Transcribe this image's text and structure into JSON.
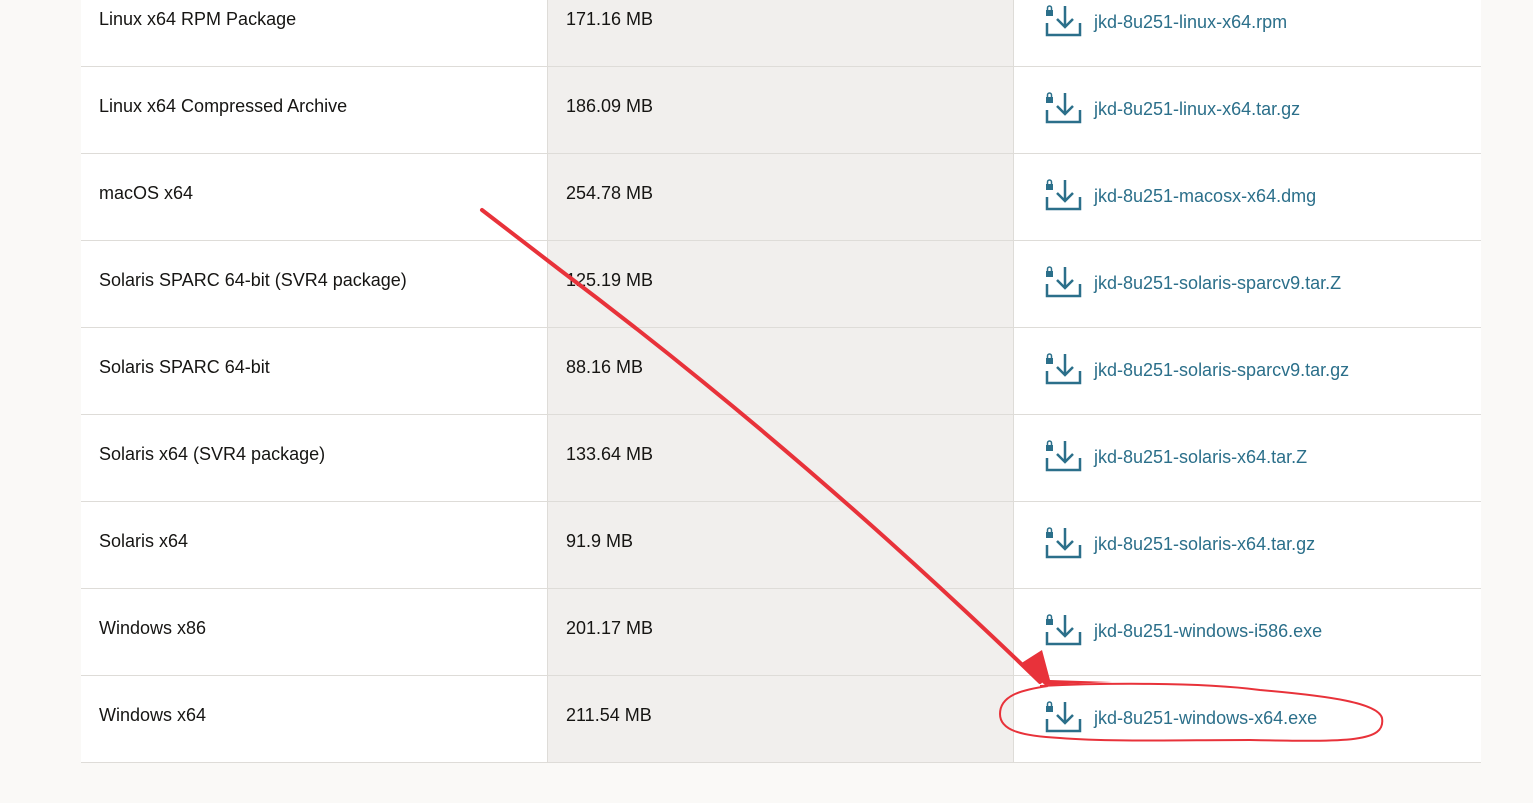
{
  "rows": [
    {
      "product": "Linux x64 RPM Package",
      "size": "171.16 MB",
      "file": "jkd-8u251-linux-x64.rpm"
    },
    {
      "product": "Linux x64 Compressed Archive",
      "size": "186.09 MB",
      "file": "jkd-8u251-linux-x64.tar.gz"
    },
    {
      "product": "macOS x64",
      "size": "254.78 MB",
      "file": "jkd-8u251-macosx-x64.dmg"
    },
    {
      "product": "Solaris SPARC 64-bit (SVR4 package)",
      "size": "125.19 MB",
      "file": "jkd-8u251-solaris-sparcv9.tar.Z"
    },
    {
      "product": "Solaris SPARC 64-bit",
      "size": "88.16 MB",
      "file": "jkd-8u251-solaris-sparcv9.tar.gz"
    },
    {
      "product": "Solaris x64 (SVR4 package)",
      "size": "133.64 MB",
      "file": "jkd-8u251-solaris-x64.tar.Z"
    },
    {
      "product": "Solaris x64",
      "size": "91.9 MB",
      "file": "jkd-8u251-solaris-x64.tar.gz"
    },
    {
      "product": "Windows x86",
      "size": "201.17 MB",
      "file": "jkd-8u251-windows-i586.exe"
    },
    {
      "product": "Windows x64",
      "size": "211.54 MB",
      "file": "jkd-8u251-windows-x64.exe"
    }
  ],
  "icons": {
    "download": "lock-download-icon"
  },
  "colors": {
    "link": "#2b6f8a",
    "icon": "#2b6f8a",
    "annotation": "#e8323a",
    "size_column_bg": "#f1efed"
  }
}
